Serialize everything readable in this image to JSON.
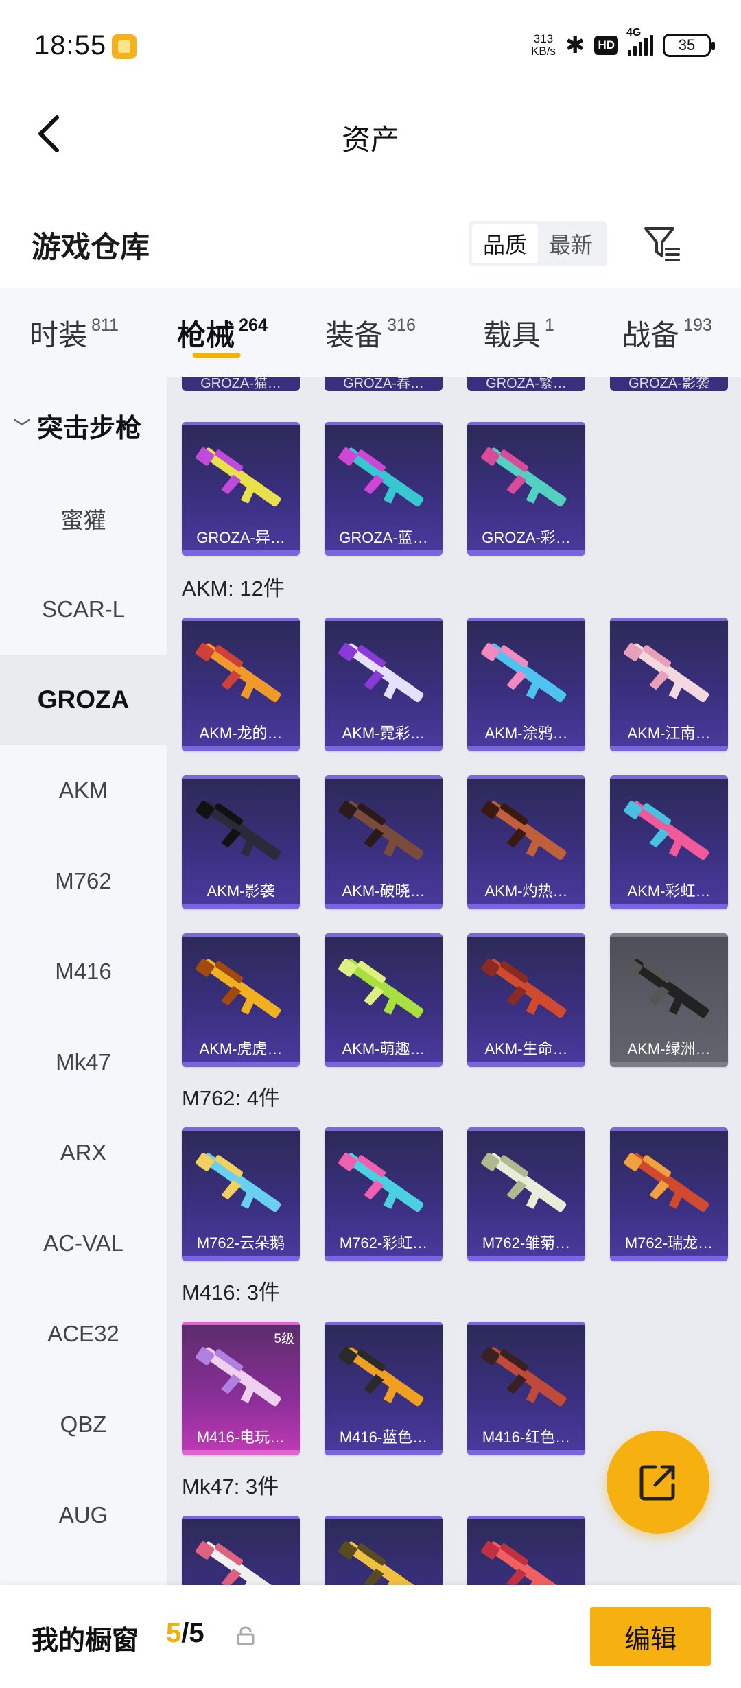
{
  "status_bar": {
    "time": "18:55",
    "net_speed_value": "313",
    "net_speed_unit": "KB/s",
    "hd": "HD",
    "network": "4G",
    "battery": "35"
  },
  "header": {
    "title": "资产"
  },
  "section": {
    "title": "游戏仓库",
    "sort_options": [
      "品质",
      "最新"
    ],
    "sort_selected": "品质"
  },
  "tabs": [
    {
      "label": "时装",
      "count": "811"
    },
    {
      "label": "枪械",
      "count": "264"
    },
    {
      "label": "装备",
      "count": "316"
    },
    {
      "label": "载具",
      "count": "1"
    },
    {
      "label": "战备",
      "count": "193"
    }
  ],
  "active_tab": "枪械",
  "sidebar": {
    "group": "突击步枪",
    "items": [
      "蜜獾",
      "SCAR-L",
      "GROZA",
      "AKM",
      "M762",
      "M416",
      "Mk47",
      "ARX",
      "AC-VAL",
      "ACE32",
      "QBZ",
      "AUG"
    ],
    "selected": "GROZA"
  },
  "main": {
    "cut_top_labels": [
      "GROZA-猫…",
      "GROZA-春…",
      "GROZA-繁…",
      "GROZA-影袭"
    ],
    "groza_items": [
      "GROZA-异…",
      "GROZA-蓝…",
      "GROZA-彩…"
    ],
    "groups": [
      {
        "title": "AKM: 12件",
        "items": [
          "AKM-龙的…",
          "AKM-霓彩…",
          "AKM-涂鸦…",
          "AKM-江南…",
          "AKM-影袭",
          "AKM-破晓…",
          "AKM-灼热…",
          "AKM-彩虹…",
          "AKM-虎虎…",
          "AKM-萌趣…",
          "AKM-生命…",
          "AKM-绿洲…"
        ]
      },
      {
        "title": "M762: 4件",
        "items": [
          "M762-云朵鹅",
          "M762-彩虹…",
          "M762-雏菊…",
          "M762-瑞龙…"
        ]
      },
      {
        "title": "M416: 3件",
        "items": [
          "M416-电玩…",
          "M416-蓝色…",
          "M416-红色…"
        ],
        "level_badge": "5级"
      },
      {
        "title": "Mk47: 3件",
        "items": [
          "",
          "",
          ""
        ]
      }
    ]
  },
  "bottom_bar": {
    "title": "我的橱窗",
    "count_current": "5",
    "count_sep": "/",
    "count_total": "5",
    "edit_label": "编辑"
  },
  "colors": {
    "accent": "#f6b110",
    "card_purple": "#3a2f7e",
    "card_gray": "#5a5d66",
    "card_pink": "#c13ab5",
    "sidebar_bg": "#f5f7fa",
    "grid_bg": "#e9ebf0"
  },
  "icons": {
    "back": "chevron-left-icon",
    "filter": "filter-icon",
    "share": "share-external-icon",
    "lock": "lock-icon"
  }
}
